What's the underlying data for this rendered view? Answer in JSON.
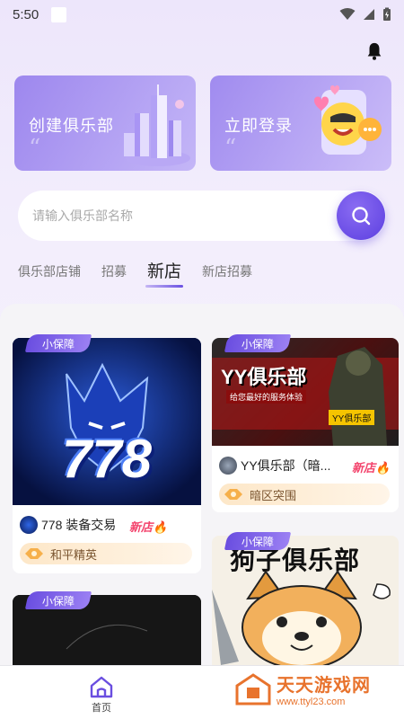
{
  "status_bar": {
    "time": "5:50"
  },
  "banners": {
    "create": {
      "label": "创建俱乐部"
    },
    "login": {
      "label": "立即登录"
    }
  },
  "search": {
    "placeholder": "请输入俱乐部名称"
  },
  "tabs": [
    {
      "label": "俱乐部店铺"
    },
    {
      "label": "招募"
    },
    {
      "label": "新店"
    },
    {
      "label": "新店招募"
    }
  ],
  "active_tab_index": 2,
  "cards": [
    {
      "tag": "小保障",
      "image_text": "778",
      "name": "778 装备交易",
      "badge": "新店🔥",
      "category": "和平精英"
    },
    {
      "tag": "小保障",
      "image_title": "YY俱乐部",
      "image_subtitle": "给您最好的服务体验",
      "image_badge": "YY俱乐部",
      "name": "YY俱乐部（暗...",
      "badge": "新店🔥",
      "category": "暗区突围"
    },
    {
      "tag": "小保障",
      "image_title": "狗子俱乐部"
    },
    {
      "tag": "小保障"
    }
  ],
  "bottom_nav": {
    "home_label": "首页"
  },
  "watermark": {
    "title": "天天游戏网",
    "url": "www.ttyl23.com"
  },
  "colors": {
    "accent": "#6a4ee0",
    "new_badge": "#f3436c",
    "pill_text": "#7a5530"
  }
}
